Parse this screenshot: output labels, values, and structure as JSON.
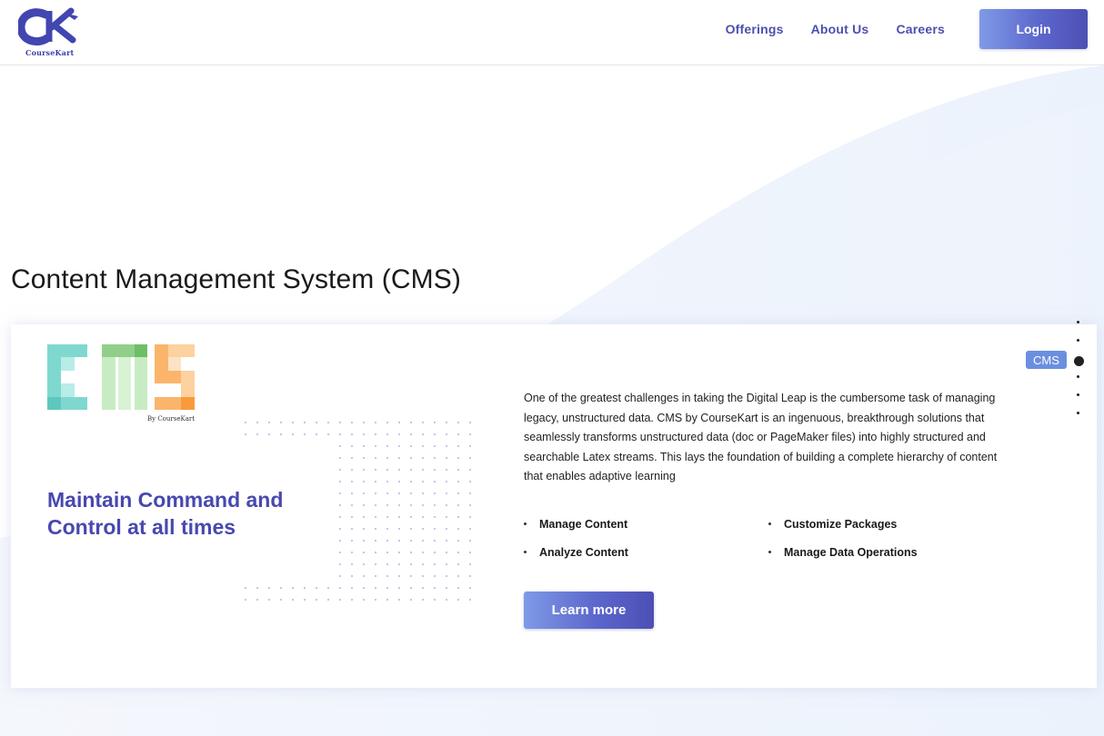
{
  "header": {
    "logo_text": "CourseKart",
    "nav": [
      {
        "label": "Offerings"
      },
      {
        "label": "About Us"
      },
      {
        "label": "Careers"
      }
    ],
    "login_label": "Login"
  },
  "page_title": "Content Management System (CMS)",
  "card": {
    "logo_caption": "By CourseKart",
    "logo_letters": "CMS",
    "tagline_line1": "Maintain Command and",
    "tagline_line2": "Control at all times",
    "description": "One of the greatest challenges in taking the Digital Leap is the cumbersome task of managing legacy, unstructured data. CMS by CourseKart is an ingenuous, breakthrough solutions that seamlessly transforms unstructured data (doc or PageMaker files) into highly structured and searchable Latex streams. This lays the foundation of building a complete hierarchy of content that enables adaptive learning",
    "features": [
      "Manage Content",
      "Customize Packages",
      "Analyze Content",
      "Manage Data Operations"
    ],
    "learn_more_label": "Learn more"
  },
  "pager": {
    "badge": "CMS",
    "total": 6,
    "active_index": 2
  },
  "colors": {
    "brand": "#4848b0",
    "button_gradient_start": "#7f9ae6",
    "button_gradient_end": "#4d4fb4",
    "badge": "#6b8fe0",
    "cms_teal": "#7fd8cf",
    "cms_green": "#90cf8a",
    "cms_orange": "#fbb56a"
  }
}
